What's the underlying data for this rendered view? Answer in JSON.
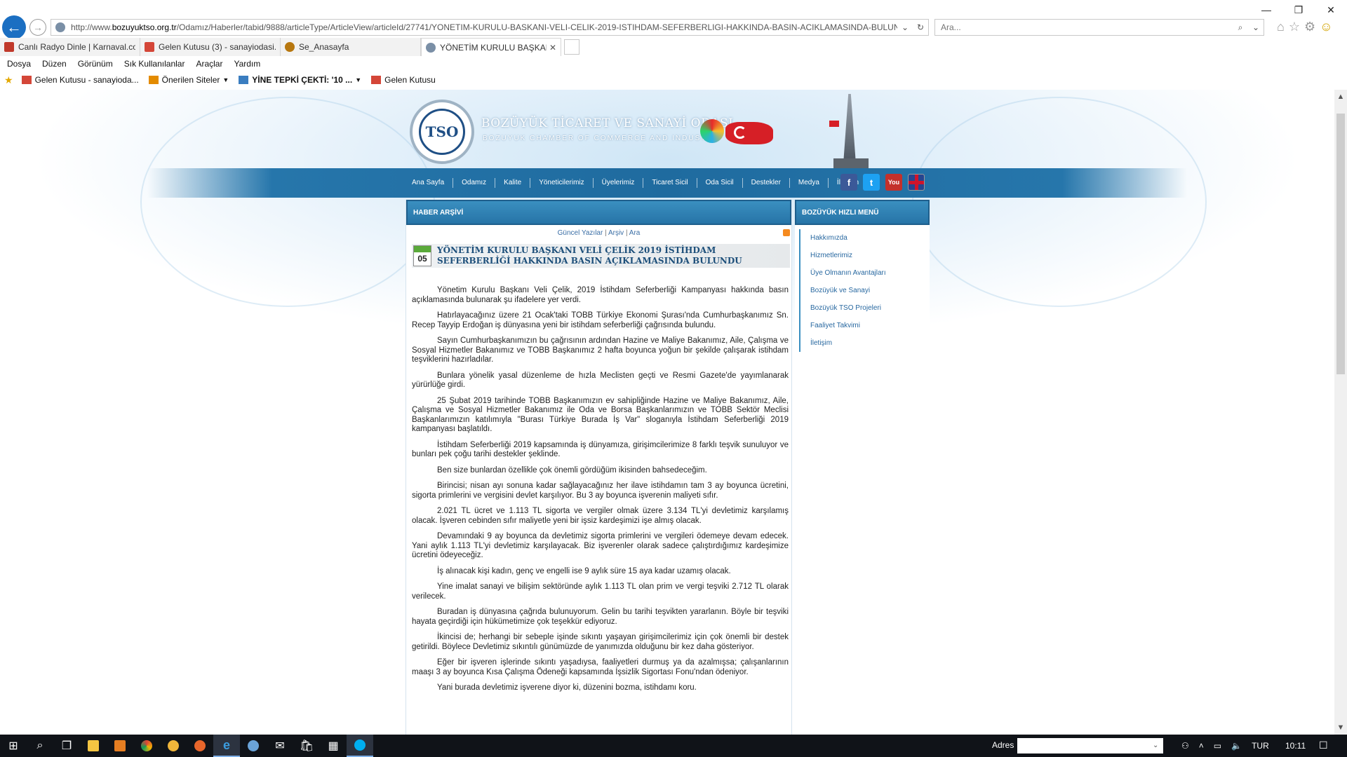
{
  "browser": {
    "url_prefix": "http://www.",
    "url_domain": "bozuyuktso.org.tr",
    "url_path": "/Odamız/Haberler/tabid/9888/articleType/ArticleView/articleId/27741/YONETIM-KURULU-BASKANI-VELI-CELIK-2019-ISTIHDAM-SEFERBERLIGI-HAKKINDA-BASIN-ACIKLAMASINDA-BULUNDU.aspx",
    "search_placeholder": "Ara...",
    "tabs": [
      {
        "label": "Canlı Radyo Dinle | Karnaval.co...",
        "icon_color": "#c0392b"
      },
      {
        "label": "Gelen Kutusu (3) - sanayiodasi...",
        "icon_color": "#d44638"
      },
      {
        "label": "Se_Anasayfa",
        "icon_color": "#b7770f"
      },
      {
        "label": "YÖNETİM KURULU BAŞKAN...",
        "icon_color": "#7a8fa6",
        "active": true
      }
    ],
    "menu": [
      "Dosya",
      "Düzen",
      "Görünüm",
      "Sık Kullanılanlar",
      "Araçlar",
      "Yardım"
    ],
    "favorites": [
      {
        "label": "Gelen Kutusu - sanayioda...",
        "icon_color": "#d44638"
      },
      {
        "label": "Önerilen Siteler",
        "icon_color": "#e38b00",
        "dropdown": true
      },
      {
        "label": "YİNE TEPKİ ÇEKTİ: '10 ...",
        "icon_color": "#3a7dc0",
        "dropdown": true,
        "bold": true
      },
      {
        "label": "Gelen Kutusu",
        "icon_color": "#d44638"
      }
    ]
  },
  "site": {
    "logo_text": "TSO",
    "org_name": "BOZÜYÜK TİCARET VE SANAYİ ODASI",
    "org_name_en": "BOZUYUK CHAMBER OF COMMERCE AND INDUSTRY",
    "nav": [
      "Ana Sayfa",
      "Odamız",
      "Kalite",
      "Yöneticilerimiz",
      "Üyelerimiz",
      "Ticaret Sicil",
      "Oda Sicil",
      "Destekler",
      "Medya",
      "İletişim"
    ],
    "social": {
      "facebook": "f",
      "twitter": "t",
      "youtube": "You"
    }
  },
  "main": {
    "panel_title": "HABER ARŞİVİ",
    "links": [
      "Güncel Yazılar",
      "Arşiv",
      "Ara"
    ],
    "date_day": "05",
    "article_title": "YÖNETİM KURULU BAŞKANI VELİ ÇELİK 2019 İSTİHDAM SEFERBERLİĞİ HAKKINDA BASIN AÇIKLAMASINDA BULUNDU",
    "paragraphs": [
      "Yönetim Kurulu Başkanı Veli Çelik, 2019 İstihdam Seferberliği Kampanyası hakkında basın açıklamasında bulunarak şu ifadelere yer verdi.",
      "Hatırlayacağınız üzere 21 Ocak'taki TOBB Türkiye Ekonomi Şurası'nda Cumhurbaşkanımız Sn. Recep Tayyip Erdoğan iş dünyasına yeni bir istihdam seferberliği çağrısında bulundu.",
      "Sayın Cumhurbaşkanımızın bu çağrısının ardından Hazine ve Maliye Bakanımız, Aile, Çalışma ve Sosyal Hizmetler Bakanımız ve TOBB Başkanımız 2 hafta boyunca yoğun bir şekilde çalışarak istihdam teşviklerini hazırladılar.",
      "Bunlara yönelik yasal düzenleme de hızla Meclisten geçti ve Resmi Gazete'de yayımlanarak yürürlüğe girdi.",
      "25 Şubat 2019 tarihinde TOBB Başkanımızın ev sahipliğinde Hazine ve Maliye Bakanımız, Aile, Çalışma ve Sosyal Hizmetler Bakanımız ile Oda ve Borsa Başkanlarımızın ve TOBB Sektör Meclisi Başkanlarımızın katılımıyla \"Burası Türkiye Burada İş Var\" sloganıyla İstihdam Seferberliği 2019 kampanyası başlatıldı.",
      "İstihdam Seferberliği 2019 kapsamında iş dünyamıza, girişimcilerimize 8 farklı teşvik sunuluyor ve bunları pek çoğu tarihi destekler şeklinde.",
      "Ben size bunlardan özellikle çok önemli gördüğüm ikisinden bahsedeceğim.",
      "Birincisi; nisan ayı sonuna kadar sağlayacağınız her ilave istihdamın tam 3 ay boyunca ücretini, sigorta primlerini ve vergisini devlet karşılıyor. Bu 3 ay boyunca işverenin maliyeti sıfır.",
      "2.021 TL ücret ve 1.113 TL sigorta ve vergiler olmak üzere 3.134 TL'yi devletimiz karşılamış olacak. İşveren cebinden sıfır maliyetle yeni bir işsiz kardeşimizi işe almış olacak.",
      "Devamındaki 9 ay boyunca da devletimiz sigorta primlerini ve vergileri ödemeye devam edecek. Yani aylık 1.113 TL'yi devletimiz karşılayacak. Biz işverenler olarak sadece çalıştırdığımız kardeşimize ücretini ödeyeceğiz.",
      "İş alınacak kişi kadın, genç ve engelli ise 9 aylık süre 15 aya kadar uzamış olacak.",
      "Yine imalat sanayi ve bilişim sektöründe aylık 1.113 TL olan prim ve vergi teşviki 2.712 TL olarak verilecek.",
      "Buradan iş dünyasına çağrıda bulunuyorum. Gelin bu tarihi teşvikten yararlanın. Böyle bir teşviki hayata geçirdiği için hükümetimize çok teşekkür ediyoruz.",
      "İkincisi de; herhangi bir sebeple işinde sıkıntı yaşayan girişimcilerimiz için çok önemli bir destek getirildi. Böylece Devletimiz sıkıntılı günümüzde de yanımızda olduğunu bir kez daha gösteriyor.",
      "Eğer bir işveren işlerinde sıkıntı yaşadıysa, faaliyetleri durmuş ya da azalmışsa; çalışanlarının maaşı 3 ay boyunca Kısa Çalışma Ödeneği kapsamında İşsizlik Sigortası Fonu'ndan ödeniyor.",
      "Yani burada devletimiz işverene diyor ki, düzenini bozma, istihdamı koru."
    ]
  },
  "sidebar": {
    "title": "BOZÜYÜK HIZLI MENÜ",
    "items": [
      "Hakkımızda",
      "Hizmetlerimiz",
      "Üye Olmanın Avantajları",
      "Bozüyük ve Sanayi",
      "Bozüyük TSO Projeleri",
      "Faaliyet Takvimi",
      "İletişim"
    ]
  },
  "taskbar": {
    "adres_label": "Adres",
    "language": "TUR",
    "clock": "10:11"
  },
  "colors": {
    "nav_blue": "#1f6b9f",
    "panel_header": "#2774a7",
    "title_blue": "#1d4f7a",
    "link_blue": "#2868a0",
    "ie_back": "#1b6fc2"
  }
}
